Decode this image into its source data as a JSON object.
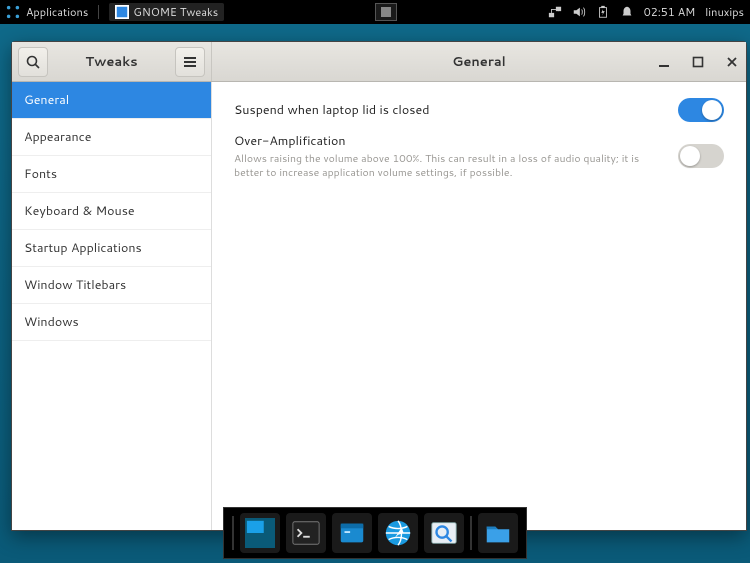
{
  "topbar": {
    "applications_label": "Applications",
    "app_name": "GNOME Tweaks",
    "clock": "02:51 AM",
    "user": "linuxips"
  },
  "window": {
    "left_title": "Tweaks",
    "right_title": "General"
  },
  "sidebar": {
    "items": [
      {
        "label": "General",
        "active": true
      },
      {
        "label": "Appearance",
        "active": false
      },
      {
        "label": "Fonts",
        "active": false
      },
      {
        "label": "Keyboard & Mouse",
        "active": false
      },
      {
        "label": "Startup Applications",
        "active": false
      },
      {
        "label": "Window Titlebars",
        "active": false
      },
      {
        "label": "Windows",
        "active": false
      }
    ]
  },
  "settings": {
    "suspend": {
      "label": "Suspend when laptop lid is closed",
      "value": true
    },
    "overamp": {
      "label": "Over-Amplification",
      "description": "Allows raising the volume above 100%. This can result in a loss of audio quality; it is better to increase application volume settings, if possible.",
      "value": false
    }
  },
  "colors": {
    "accent": "#2d87e2"
  }
}
